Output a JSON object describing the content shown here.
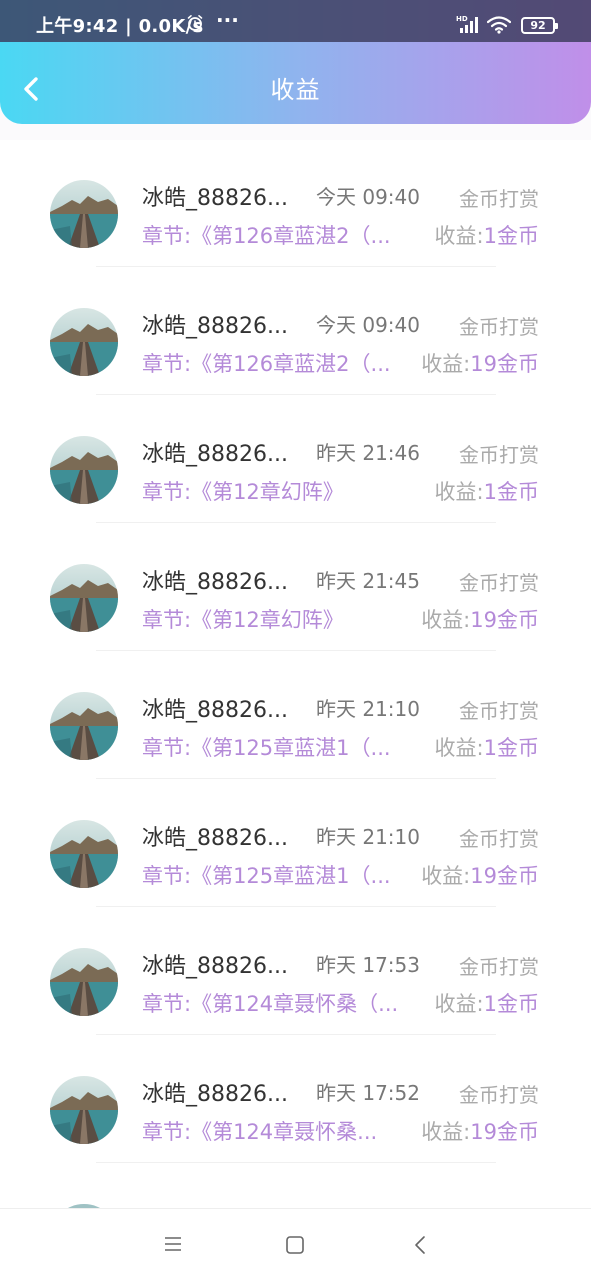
{
  "status_bar": {
    "time": "上午9:42 | 0.0K/s",
    "more": "···",
    "battery": "92"
  },
  "header": {
    "title": "收益"
  },
  "list": {
    "income_label": "收益:",
    "items": [
      {
        "name": "冰皓_88826...",
        "time": "今天 09:40",
        "type": "金币打赏",
        "chapter": "章节:《第126章蓝湛2（...",
        "income": "1金币"
      },
      {
        "name": "冰皓_88826...",
        "time": "今天 09:40",
        "type": "金币打赏",
        "chapter": "章节:《第126章蓝湛2（...",
        "income": "19金币"
      },
      {
        "name": "冰皓_88826...",
        "time": "昨天 21:46",
        "type": "金币打赏",
        "chapter": "章节:《第12章幻阵》",
        "income": "1金币"
      },
      {
        "name": "冰皓_88826...",
        "time": "昨天 21:45",
        "type": "金币打赏",
        "chapter": "章节:《第12章幻阵》",
        "income": "19金币"
      },
      {
        "name": "冰皓_88826...",
        "time": "昨天 21:10",
        "type": "金币打赏",
        "chapter": "章节:《第125章蓝湛1（...",
        "income": "1金币"
      },
      {
        "name": "冰皓_88826...",
        "time": "昨天 21:10",
        "type": "金币打赏",
        "chapter": "章节:《第125章蓝湛1（...",
        "income": "19金币"
      },
      {
        "name": "冰皓_88826...",
        "time": "昨天 17:53",
        "type": "金币打赏",
        "chapter": "章节:《第124章聂怀桑（...",
        "income": "1金币"
      },
      {
        "name": "冰皓_88826...",
        "time": "昨天 17:52",
        "type": "金币打赏",
        "chapter": "章节:《第124章聂怀桑...",
        "income": "19金币"
      }
    ]
  },
  "colors": {
    "header_gradient_start": "#4ad8f3",
    "header_gradient_end": "#c08fe9",
    "accent_purple": "#b48ad8"
  },
  "icons": {
    "back": "chevron-left-icon",
    "alarm": "alarm-icon",
    "wifi": "wifi-icon",
    "signal": "signal-icon",
    "menu": "menu-icon",
    "home": "home-icon",
    "nav_back": "back-icon"
  }
}
